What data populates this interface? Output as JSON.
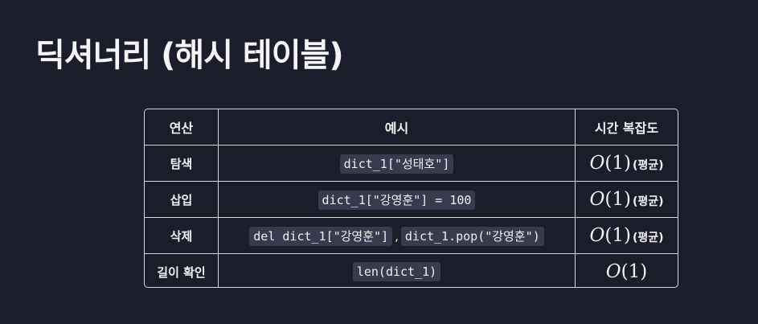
{
  "title": "딕셔너리 (해시 테이블)",
  "table": {
    "headers": [
      "연산",
      "예시",
      "시간 복잡도"
    ],
    "rows": [
      {
        "operation": "탐색",
        "examples": [
          "dict_1[\"성태호\"]"
        ],
        "complexity": {
          "letter": "O",
          "arg": "(1)",
          "note": "(평균)"
        }
      },
      {
        "operation": "삽입",
        "examples": [
          "dict_1[\"강영훈\"] = 100"
        ],
        "complexity": {
          "letter": "O",
          "arg": "(1)",
          "note": "(평균)"
        }
      },
      {
        "operation": "삭제",
        "examples": [
          "del dict_1[\"강영훈\"]",
          "dict_1.pop(\"강영훈\")"
        ],
        "separator": ",",
        "complexity": {
          "letter": "O",
          "arg": "(1)",
          "note": "(평균)"
        }
      },
      {
        "operation": "길이 확인",
        "examples": [
          "len(dict_1)"
        ],
        "complexity": {
          "letter": "O",
          "arg": "(1)",
          "note": ""
        }
      }
    ]
  }
}
